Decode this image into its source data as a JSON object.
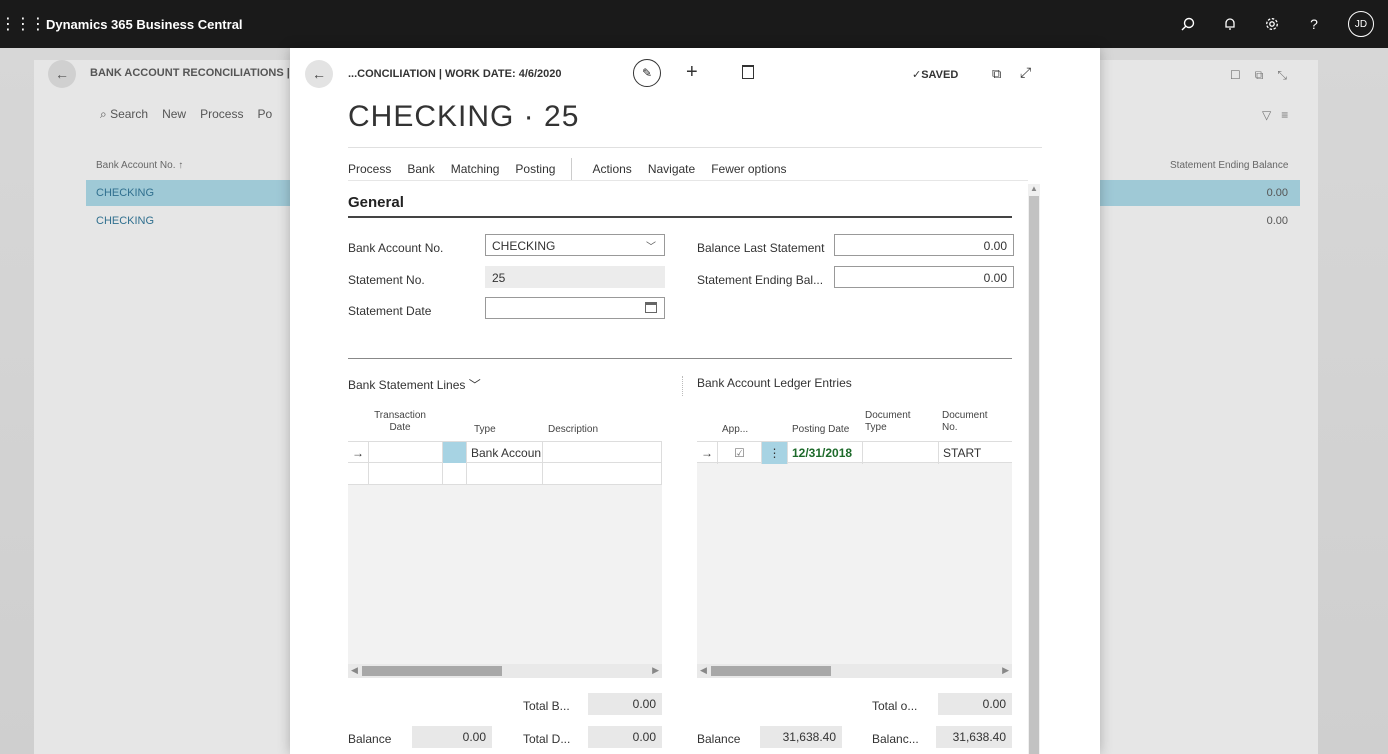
{
  "app": {
    "title": "Dynamics 365 Business Central",
    "user_initials": "JD"
  },
  "background": {
    "breadcrumb": "BANK ACCOUNT RECONCILIATIONS | W",
    "actions": [
      "Search",
      "New",
      "Process",
      "Po"
    ],
    "col_left": "Bank Account No. ↑",
    "col_right": "Statement Ending Balance",
    "rows": [
      {
        "account": "CHECKING",
        "balance": "0.00"
      },
      {
        "account": "CHECKING",
        "balance": "0.00"
      }
    ]
  },
  "dialog": {
    "breadcrumb": "...CONCILIATION | WORK DATE: 4/6/2020",
    "saved": "SAVED",
    "title": "CHECKING · 25",
    "menu": [
      "Process",
      "Bank",
      "Matching",
      "Posting",
      "Actions",
      "Navigate",
      "Fewer options"
    ],
    "general": {
      "title": "General",
      "bank_account_no_label": "Bank Account No.",
      "bank_account_no": "CHECKING",
      "statement_no_label": "Statement No.",
      "statement_no": "25",
      "statement_date_label": "Statement Date",
      "statement_date": "",
      "balance_last_label": "Balance Last Statement",
      "balance_last": "0.00",
      "statement_ending_label": "Statement Ending Bal...",
      "statement_ending": "0.00"
    },
    "statement_lines": {
      "title": "Bank Statement Lines",
      "headers": [
        "Transaction Date",
        "Type",
        "Description"
      ],
      "row_type": "Bank Accoun",
      "totals": {
        "total_b_label": "Total B...",
        "total_b": "0.00",
        "balance_label": "Balance",
        "balance": "0.00",
        "total_d_label": "Total D...",
        "total_d": "0.00"
      }
    },
    "ledger_entries": {
      "title": "Bank Account Ledger Entries",
      "headers": [
        "App...",
        "Posting Date",
        "Document Type",
        "Document No."
      ],
      "row": {
        "posting_date": "12/31/2018",
        "document_no": "START"
      },
      "totals": {
        "total_o_label": "Total o...",
        "total_o": "0.00",
        "balance_label": "Balance",
        "balance": "31,638.40",
        "balanc_label": "Balanc...",
        "balanc": "31,638.40"
      }
    }
  }
}
